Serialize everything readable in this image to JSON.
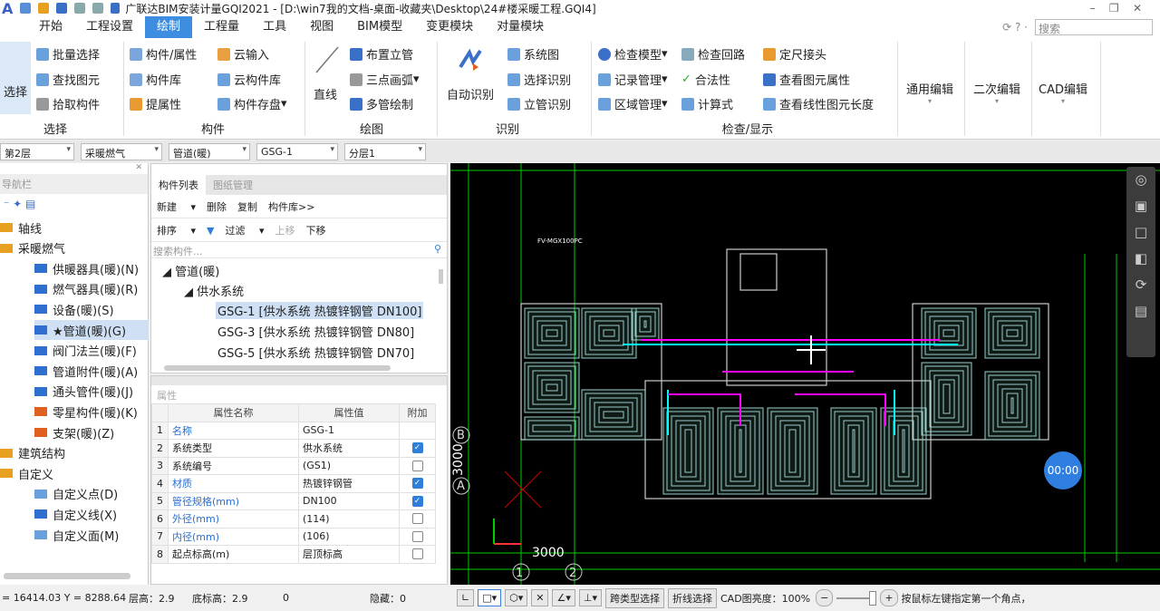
{
  "title": "广联达BIM安装计量GQI2021 - [D:\\win7我的文档-桌面-收藏夹\\Desktop\\24#楼采暖工程.GQI4]",
  "menu": [
    "开始",
    "工程设置",
    "绘制",
    "工程量",
    "工具",
    "视图",
    "BIM模型",
    "变更模块",
    "对量模块"
  ],
  "search_placeholder": "搜索",
  "ribbon": {
    "select": "选择",
    "batch": "批量选择",
    "find": "查找图元",
    "pick": "拾取构件",
    "comp_attr": "构件/属性",
    "comp_lib": "构件库",
    "extract": "提属性",
    "cloud_in": "云输入",
    "cloud_lib": "云构件库",
    "comp_save": "构件存盘",
    "line": "直线",
    "riser": "布置立管",
    "arc": "三点画弧",
    "multi": "多管绘制",
    "auto": "自动识别",
    "sysmap": "系统图",
    "selrec": "选择识别",
    "riserrec": "立管识别",
    "check_model": "检查模型",
    "record": "记录管理",
    "area": "区域管理",
    "loop": "检查回路",
    "legal": "合法性",
    "calc": "计算式",
    "fixed": "定尺接头",
    "view_attr": "查看图元属性",
    "view_len": "查看线性图元长度",
    "gen_edit": "通用编辑",
    "sec_edit": "二次编辑",
    "cad_edit": "CAD编辑",
    "g_select": "选择",
    "g_comp": "构件",
    "g_draw": "绘图",
    "g_rec": "识别",
    "g_check": "检查/显示"
  },
  "selectors": [
    "第2层",
    "采暖燃气",
    "管道(暖)",
    "GSG-1",
    "分层1"
  ],
  "nav": {
    "title": "导航栏",
    "items": [
      "轴线",
      "采暖燃气",
      "供暖器具(暖)(N)",
      "燃气器具(暖)(R)",
      "设备(暖)(S)",
      "★管道(暖)(G)",
      "阀门法兰(暖)(F)",
      "管道附件(暖)(A)",
      "通头管件(暖)(J)",
      "零星构件(暖)(K)",
      "支架(暖)(Z)",
      "建筑结构",
      "自定义",
      "自定义点(D)",
      "自定义线(X)",
      "自定义面(M)"
    ]
  },
  "complist": {
    "tabs": [
      "构件列表",
      "图纸管理"
    ],
    "new": "新建",
    "delete": "删除",
    "copy": "复制",
    "lib": "构件库>>",
    "sort": "排序",
    "filter": "过滤",
    "up": "上移",
    "down": "下移",
    "search_placeholder": "搜索构件...",
    "tree": [
      "管道(暖)",
      "供水系统",
      "GSG-1 [供水系统 热镀锌钢管 DN100]",
      "GSG-3 [供水系统 热镀锌钢管 DN80]",
      "GSG-5 [供水系统 热镀锌钢管 DN70]"
    ]
  },
  "props": {
    "title": "属性",
    "headers": [
      "属性名称",
      "属性值",
      "附加"
    ],
    "rows": [
      {
        "n": "1",
        "name": "名称",
        "value": "GSG-1",
        "checked": null
      },
      {
        "n": "2",
        "name": "系统类型",
        "value": "供水系统",
        "checked": true
      },
      {
        "n": "3",
        "name": "系统编号",
        "value": "(GS1)",
        "checked": false
      },
      {
        "n": "4",
        "name": "材质",
        "value": "热镀锌钢管",
        "checked": true
      },
      {
        "n": "5",
        "name": "管径规格(mm)",
        "value": "DN100",
        "checked": true
      },
      {
        "n": "6",
        "name": "外径(mm)",
        "value": "(114)",
        "checked": false
      },
      {
        "n": "7",
        "name": "内径(mm)",
        "value": "(106)",
        "checked": false
      },
      {
        "n": "8",
        "name": "起点标高(m)",
        "value": "层顶标高",
        "checked": false
      }
    ]
  },
  "cad": {
    "axis_b": "B",
    "axis_a": "A",
    "dim_v": "3000",
    "dim_h": "3000",
    "axis_1": "1",
    "axis_2": "2",
    "timer": "00:00",
    "note": "FV-MGX100PC"
  },
  "status": {
    "coords": "= 16414.03 Y = 8288.64",
    "floor_h": "层高：2.9",
    "base_h": "底标高：2.9",
    "zero": "0",
    "hidden": "隐藏：0",
    "cross_sel": "跨类型选择",
    "poly_sel": "折线选择",
    "brightness": "CAD图亮度：100%",
    "hint": "按鼠标左键指定第一个角点，"
  }
}
